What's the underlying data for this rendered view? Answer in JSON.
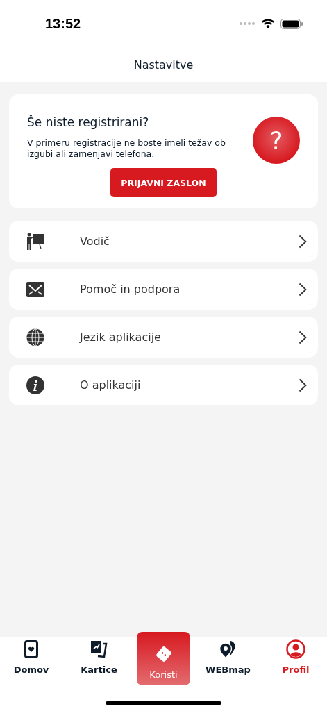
{
  "status_bar": {
    "time": "13:52"
  },
  "header": {
    "title": "Nastavitve"
  },
  "register_card": {
    "title": "Še niste registrirani?",
    "text": "V primeru registracije ne boste imeli težav ob izgubi ali zamenjavi telefona.",
    "icon_text": "?",
    "button": "PRIJAVNI ZASLON"
  },
  "menu": [
    {
      "label": "Vodič"
    },
    {
      "label": "Pomoč in podpora"
    },
    {
      "label": "Jezik aplikacije"
    },
    {
      "label": "O aplikaciji"
    }
  ],
  "tabs": [
    {
      "label": "Domov",
      "kind": "normal",
      "selected": false
    },
    {
      "label": "Kartice",
      "kind": "normal",
      "selected": false
    },
    {
      "label": "Koristi",
      "kind": "featured",
      "selected": false
    },
    {
      "label": "WEBmap",
      "kind": "normal",
      "selected": false
    },
    {
      "label": "Profil",
      "kind": "normal",
      "selected": true
    }
  ]
}
